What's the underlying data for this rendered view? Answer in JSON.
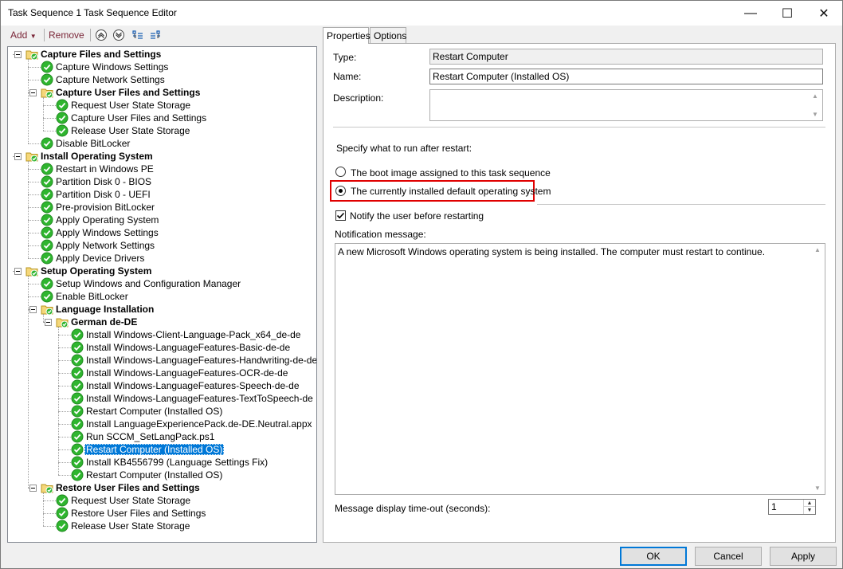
{
  "window": {
    "title": "Task Sequence 1 Task Sequence Editor",
    "controls": {
      "minimize": "—",
      "maximize": "☐",
      "close": "✕"
    }
  },
  "toolbar": {
    "add": "Add",
    "remove": "Remove"
  },
  "tree": [
    {
      "text": "Capture Files and Settings",
      "kind": "group",
      "level": 0,
      "expander": true
    },
    {
      "text": "Capture Windows Settings",
      "kind": "step",
      "level": 1
    },
    {
      "text": "Capture Network Settings",
      "kind": "step",
      "level": 1
    },
    {
      "text": "Capture User Files and Settings",
      "kind": "group",
      "level": 1,
      "expander": true
    },
    {
      "text": "Request User State Storage",
      "kind": "step",
      "level": 2
    },
    {
      "text": "Capture User Files and Settings",
      "kind": "step",
      "level": 2
    },
    {
      "text": "Release User State Storage",
      "kind": "step",
      "level": 2
    },
    {
      "text": "Disable BitLocker",
      "kind": "step",
      "level": 1
    },
    {
      "text": "Install Operating System",
      "kind": "group",
      "level": 0,
      "expander": true
    },
    {
      "text": "Restart in Windows PE",
      "kind": "step",
      "level": 1
    },
    {
      "text": "Partition Disk 0 - BIOS",
      "kind": "step",
      "level": 1
    },
    {
      "text": "Partition Disk 0 - UEFI",
      "kind": "step",
      "level": 1
    },
    {
      "text": "Pre-provision BitLocker",
      "kind": "step",
      "level": 1
    },
    {
      "text": "Apply Operating System",
      "kind": "step",
      "level": 1
    },
    {
      "text": "Apply Windows Settings",
      "kind": "step",
      "level": 1
    },
    {
      "text": "Apply Network Settings",
      "kind": "step",
      "level": 1
    },
    {
      "text": "Apply Device Drivers",
      "kind": "step",
      "level": 1
    },
    {
      "text": "Setup Operating System",
      "kind": "group",
      "level": 0,
      "expander": true
    },
    {
      "text": "Setup Windows and Configuration Manager",
      "kind": "step",
      "level": 1
    },
    {
      "text": "Enable BitLocker",
      "kind": "step",
      "level": 1
    },
    {
      "text": "Language Installation",
      "kind": "group",
      "level": 1,
      "expander": true
    },
    {
      "text": "German de-DE",
      "kind": "group",
      "level": 2,
      "expander": true
    },
    {
      "text": "Install Windows-Client-Language-Pack_x64_de-de",
      "kind": "step",
      "level": 3
    },
    {
      "text": "Install Windows-LanguageFeatures-Basic-de-de",
      "kind": "step",
      "level": 3
    },
    {
      "text": "Install Windows-LanguageFeatures-Handwriting-de-de",
      "kind": "step",
      "level": 3
    },
    {
      "text": "Install Windows-LanguageFeatures-OCR-de-de",
      "kind": "step",
      "level": 3
    },
    {
      "text": "Install Windows-LanguageFeatures-Speech-de-de",
      "kind": "step",
      "level": 3
    },
    {
      "text": "Install Windows-LanguageFeatures-TextToSpeech-de",
      "kind": "step",
      "level": 3
    },
    {
      "text": "Restart Computer (Installed OS)",
      "kind": "step",
      "level": 3
    },
    {
      "text": "Install LanguageExperiencePack.de-DE.Neutral.appx",
      "kind": "step",
      "level": 3
    },
    {
      "text": "Run SCCM_SetLangPack.ps1",
      "kind": "step",
      "level": 3
    },
    {
      "text": "Restart Computer (Installed OS)",
      "kind": "step",
      "level": 3,
      "selected": true
    },
    {
      "text": "Install KB4556799 (Language Settings Fix)",
      "kind": "step",
      "level": 3
    },
    {
      "text": "Restart Computer (Installed OS)",
      "kind": "step",
      "level": 3
    },
    {
      "text": "Restore User Files and Settings",
      "kind": "group",
      "level": 1,
      "expander": true
    },
    {
      "text": "Request User State Storage",
      "kind": "step",
      "level": 2
    },
    {
      "text": "Restore User Files and Settings",
      "kind": "step",
      "level": 2
    },
    {
      "text": "Release User State Storage",
      "kind": "step",
      "level": 2
    }
  ],
  "tabs": {
    "properties": "Properties",
    "options": "Options"
  },
  "properties": {
    "type_label": "Type:",
    "type_value": "Restart Computer",
    "name_label": "Name:",
    "name_value": "Restart Computer (Installed OS)",
    "description_label": "Description:",
    "description_value": "",
    "specify_label": "Specify what to run after restart:",
    "radio_boot": "The boot image assigned to this task sequence",
    "radio_installed": "The currently installed default operating system",
    "notify_label": "Notify the user before restarting",
    "notify_checked": true,
    "notification_label": "Notification message:",
    "notification_value": "A new Microsoft Windows operating system is being installed. The computer must restart to continue.",
    "timeout_label": "Message display time-out (seconds):",
    "timeout_value": "1"
  },
  "buttons": {
    "ok": "OK",
    "cancel": "Cancel",
    "apply": "Apply"
  },
  "colors": {
    "accent": "#0078d7",
    "highlight_box": "#e00000",
    "toolbar_text": "#7a2638",
    "success_green": "#2fb52f"
  }
}
